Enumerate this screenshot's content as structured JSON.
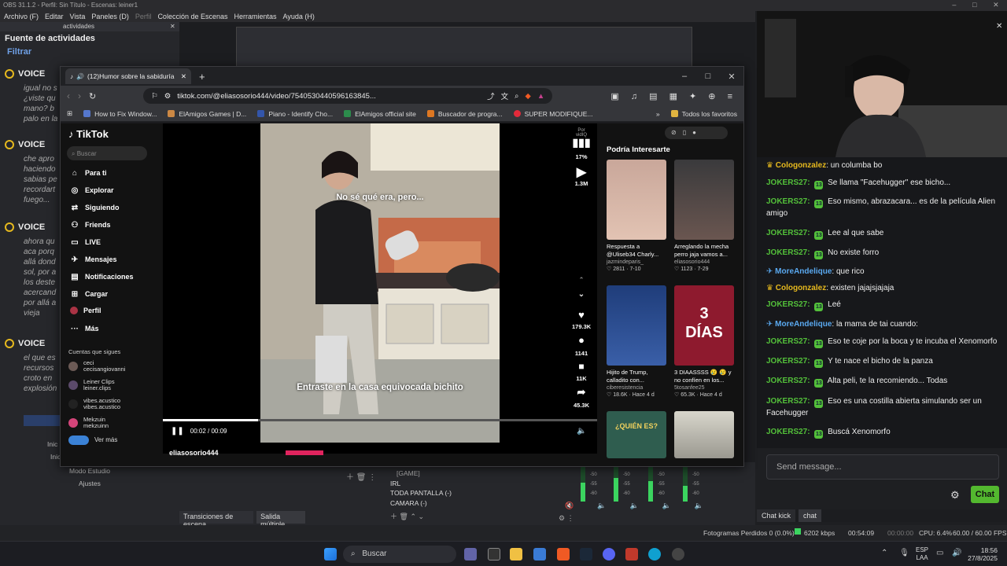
{
  "obs": {
    "title": "OBS 31.1.2 - Perfil: Sin Título - Escenas: leiner1",
    "menu": [
      "Archivo (F)",
      "Editar",
      "Vista",
      "Paneles (D)",
      "Perfil",
      "Colección de Escenas",
      "Herramientas",
      "Ayuda (H)"
    ],
    "dock_tab": "actividades",
    "dock_title": "Fuente de actividades",
    "filter": "Filtrar",
    "voice_label": "VOICE",
    "voice_texts": [
      "igual no s\n¿viste qu\nmano? b\npalo en la",
      "che apro\nhaciendo\nsabias pe\nrecordart\nfuego...",
      "ahora qu\naca porq\nallá dond\nsol, por a\nlos deste\nacercand\npor allá a\nvieja",
      "el que es\nrecursos\ncroto en\nexplosión"
    ],
    "left_buttons": [
      "Inic",
      "Inic",
      "Modo Estudio",
      "Ajustes"
    ],
    "bottom_tabs": [
      "Transiciones de escena",
      "Salida múltiple"
    ],
    "sources": [
      "[GAME]",
      "IRL",
      "TODA PANTALLA (-)",
      "CAMARA (-)"
    ],
    "mixer_ticks": [
      "-50",
      "-55",
      "-60"
    ],
    "status": {
      "dropped": "Fotogramas Perdidos 0 (0.0%)",
      "bitrate": "6202 kbps",
      "time1": "00:54:09",
      "time2": "00:00:00",
      "cpu": "CPU: 6.4%",
      "fps": "60.00 / 60.00 FPS"
    }
  },
  "browser": {
    "tab_title": "(12)Humor sobre la sabiduría",
    "url": "tiktok.com/@eliasosorio444/video/7540530440596163845...",
    "bookmarks": [
      "How to Fix Window...",
      "ElAmigos Games | D...",
      "Piano - Identify Cho...",
      "ElAmigos official site",
      "Buscador de progra...",
      "SUPER MODIFIQUE..."
    ],
    "bookmarks_all": "Todos los favoritos"
  },
  "tiktok": {
    "logo": "TikTok",
    "search_placeholder": "Buscar",
    "nav": [
      "Para ti",
      "Explorar",
      "Siguiendo",
      "Friends",
      "LIVE",
      "Mensajes",
      "Notificaciones",
      "Cargar",
      "Perfil",
      "Más"
    ],
    "following_title": "Cuentas que sigues",
    "following": [
      {
        "name": "ceci",
        "handle": "cecisangiovanni"
      },
      {
        "name": "Leiner Clips",
        "handle": "leiner.clips"
      },
      {
        "name": "vibes.acustico",
        "handle": "vibes.acustico"
      },
      {
        "name": "Mekzuin",
        "handle": "mekzuinn"
      }
    ],
    "see_more": "Ver más",
    "caption_top": "No sé qué era, pero...",
    "caption_bottom": "Entraste en la casa equivocada bichito",
    "time": "00:02 / 00:09",
    "progress": 0.22,
    "author": "eliasosorio444",
    "por_vidiq": "Por vidIQ",
    "stats": {
      "pct": "17%",
      "views": "1.3M",
      "likes": "179.3K",
      "comments": "1141",
      "saves": "11K",
      "shares": "45.3K"
    },
    "suggest_title": "Podría Interesarte",
    "cards": [
      {
        "title": "Respuesta a @Uliseb34 Charly...",
        "user": "jazmindeparis_",
        "stat": "♡ 2811 · 7-10"
      },
      {
        "title": "Arreglando la mecha perro jaja vamos a...",
        "user": "eliasosorio444",
        "stat": "♡ 1123 · 7-29"
      },
      {
        "title": "Hijito de Trump, calladito con...",
        "user": "ciberesistencia",
        "stat": "♡ 18.6K · Hace 4 d"
      },
      {
        "title": "3 DIAASSSS 😢 😢 y no confíen en los...",
        "user": "5tosanfee25",
        "stat": "♡ 65.3K · Hace 4 d"
      }
    ],
    "card_overlay_2": "3\nDÍAS",
    "card_overlay_5": "¿QUIÉN ES?"
  },
  "chat": {
    "messages": [
      {
        "user": "Cologonzalez",
        "text": ": un columba bo",
        "color": "#e6b91e",
        "badge": "crown"
      },
      {
        "user": "JOKERS27:",
        "text": "Se llama \"Facehugger\" ese bicho...",
        "color": "#53c03a",
        "badge": "13"
      },
      {
        "user": "JOKERS27:",
        "text": "Eso mismo, abrazacara... es de la película Alien amigo",
        "color": "#53c03a",
        "badge": "13"
      },
      {
        "user": "JOKERS27:",
        "text": "Lee al que sabe",
        "color": "#53c03a",
        "badge": "13"
      },
      {
        "user": "JOKERS27:",
        "text": "No existe forro",
        "color": "#53c03a",
        "badge": "13"
      },
      {
        "user": "MoreAndelique",
        "text": ": que rico",
        "color": "#5aa9f0",
        "badge": "pin"
      },
      {
        "user": "Cologonzalez",
        "text": ": existen jajajsjajaja",
        "color": "#e6b91e",
        "badge": "crown"
      },
      {
        "user": "JOKERS27:",
        "text": "Leé",
        "color": "#53c03a",
        "badge": "13"
      },
      {
        "user": "MoreAndelique",
        "text": ": la mama de tai cuando:",
        "color": "#5aa9f0",
        "badge": "pin"
      },
      {
        "user": "JOKERS27:",
        "text": "Eso te coje por la boca y te incuba el Xenomorfo",
        "color": "#53c03a",
        "badge": "13"
      },
      {
        "user": "JOKERS27:",
        "text": "Y te nace el bicho de la panza",
        "color": "#53c03a",
        "badge": "13"
      },
      {
        "user": "JOKERS27:",
        "text": "Alta peli, te la recomiendo... Todas",
        "color": "#53c03a",
        "badge": "13"
      },
      {
        "user": "JOKERS27:",
        "text": "Eso es una costilla abierta simulando ser un Facehugger",
        "color": "#53c03a",
        "badge": "13"
      },
      {
        "user": "JOKERS27:",
        "text": "Buscá Xenomorfo",
        "color": "#53c03a",
        "badge": "13"
      }
    ],
    "input_placeholder": "Send message...",
    "send": "Chat",
    "tabs": [
      "Chat kick",
      "chat"
    ]
  },
  "taskbar": {
    "search": "Buscar",
    "lang1": "ESP",
    "lang2": "LAA",
    "time": "18:56",
    "date": "27/8/2025"
  }
}
